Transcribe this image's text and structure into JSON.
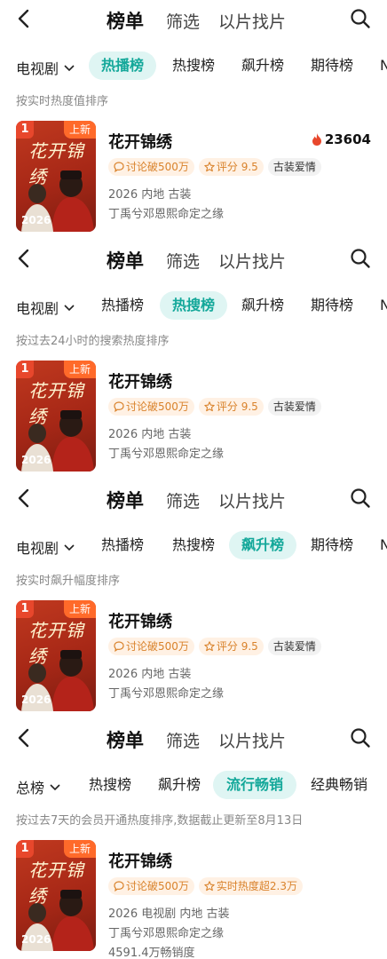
{
  "sections": [
    {
      "nav": {
        "title": "榜单",
        "filter": "筛选",
        "find": "以片找片"
      },
      "dropdown": "电视剧",
      "chips": [
        "热播榜",
        "热搜榜",
        "飙升榜",
        "期待榜",
        "N"
      ],
      "active_chip": 0,
      "sort_note": "按实时热度值排序",
      "card": {
        "rank": "1",
        "badge": "上新",
        "poster_title": "花开锦绣",
        "poster_year": "2026",
        "title": "花开锦绣",
        "heat": "23604",
        "tags": [
          "讨论破500万",
          "评分 9.5",
          "古装爱情"
        ],
        "meta1": "2026 内地 古装",
        "meta2": "丁禹兮邓恩熙命定之缘",
        "meta3": ""
      }
    },
    {
      "nav": {
        "title": "榜单",
        "filter": "筛选",
        "find": "以片找片"
      },
      "dropdown": "电视剧",
      "chips": [
        "热播榜",
        "热搜榜",
        "飙升榜",
        "期待榜",
        "N"
      ],
      "active_chip": 1,
      "sort_note": "按过去24小时的搜索热度排序",
      "card": {
        "rank": "1",
        "badge": "上新",
        "poster_title": "花开锦绣",
        "poster_year": "2026",
        "title": "花开锦绣",
        "heat": "",
        "tags": [
          "讨论破500万",
          "评分 9.5",
          "古装爱情"
        ],
        "meta1": "2026 内地 古装",
        "meta2": "丁禹兮邓恩熙命定之缘",
        "meta3": ""
      }
    },
    {
      "nav": {
        "title": "榜单",
        "filter": "筛选",
        "find": "以片找片"
      },
      "dropdown": "电视剧",
      "chips": [
        "热播榜",
        "热搜榜",
        "飙升榜",
        "期待榜",
        "N"
      ],
      "active_chip": 2,
      "sort_note": "按实时飙升幅度排序",
      "card": {
        "rank": "1",
        "badge": "上新",
        "poster_title": "花开锦绣",
        "poster_year": "2026",
        "title": "花开锦绣",
        "heat": "",
        "tags": [
          "讨论破500万",
          "评分 9.5",
          "古装爱情"
        ],
        "meta1": "2026 内地 古装",
        "meta2": "丁禹兮邓恩熙命定之缘",
        "meta3": ""
      }
    },
    {
      "nav": {
        "title": "榜单",
        "filter": "筛选",
        "find": "以片找片"
      },
      "dropdown": "总榜",
      "chips": [
        "热搜榜",
        "飙升榜",
        "流行畅销",
        "经典畅销"
      ],
      "active_chip": 2,
      "sort_note": "按过去7天的会员开通热度排序,数据截止更新至8月13日",
      "card": {
        "rank": "1",
        "badge": "上新",
        "poster_title": "花开锦绣",
        "poster_year": "2026",
        "title": "花开锦绣",
        "heat": "",
        "tags": [
          "讨论破500万",
          "实时热度超2.3万"
        ],
        "meta1": "2026 电视剧 内地 古装",
        "meta2": "丁禹兮邓恩熙命定之缘",
        "meta3": "4591.4万畅销度"
      }
    }
  ],
  "colors": {
    "accent": "#14a89a",
    "chip_bg": "#dff5f3",
    "tag_orange": "#d9822b",
    "rank_red": "#e8472c",
    "badge_orange": "#ff6a2a"
  }
}
